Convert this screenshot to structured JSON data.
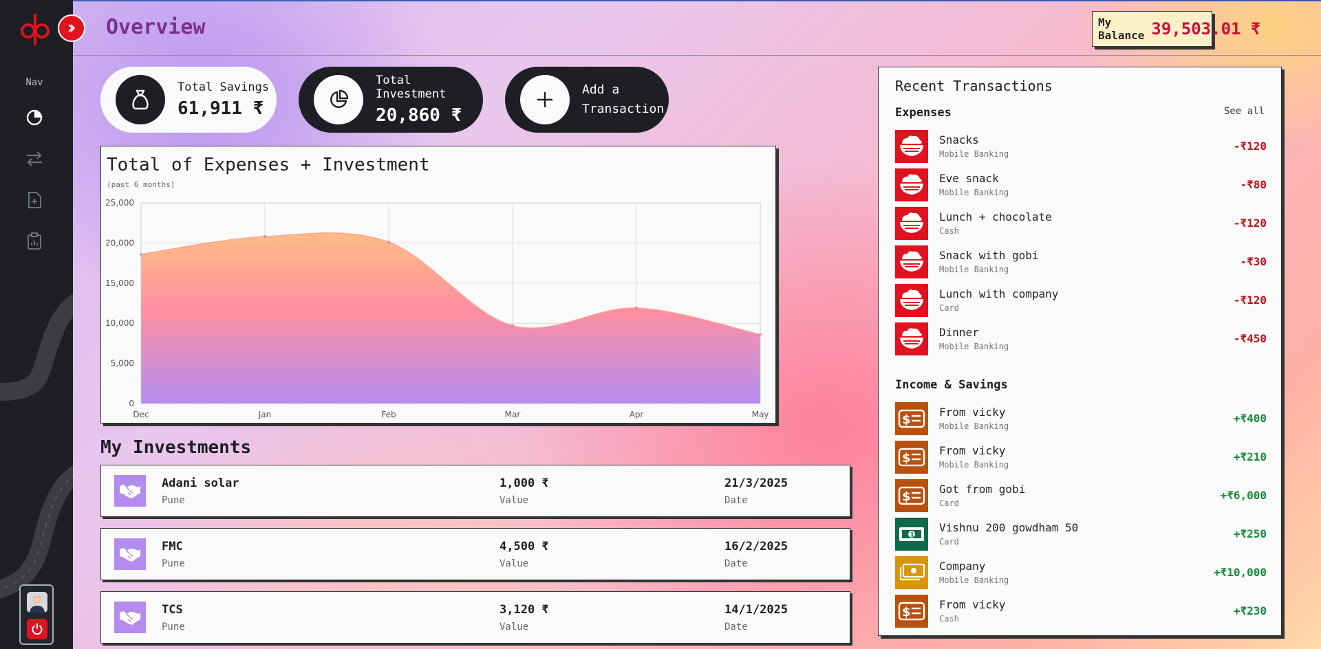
{
  "app": {
    "title": "Overview"
  },
  "sidebar": {
    "nav_label": "Nav"
  },
  "balance": {
    "label": "My Balance",
    "value": "39,503.01 ₹"
  },
  "stats": {
    "savings": {
      "label": "Total Savings",
      "value": "61,911 ₹"
    },
    "investment": {
      "label": "Total Investment",
      "value": "20,860 ₹"
    },
    "add": {
      "line1": "Add a",
      "line2": "Transaction"
    }
  },
  "chart": {
    "title": "Total of Expenses + Investment",
    "subtitle": "(past 6 months)"
  },
  "chart_data": {
    "type": "area",
    "title": "Total of Expenses + Investment",
    "subtitle": "(past 6 months)",
    "categories": [
      "Dec",
      "Jan",
      "Feb",
      "Mar",
      "Apr",
      "May"
    ],
    "series": [
      {
        "values": [
          18600,
          20800,
          20100,
          9700,
          11900,
          8600
        ]
      }
    ],
    "ylim": [
      0,
      25000
    ],
    "yticks": [
      0,
      5000,
      10000,
      15000,
      20000,
      25000
    ],
    "ytick_labels": [
      "0",
      "5,000",
      "10,000",
      "15,000",
      "20,000",
      "25,000"
    ],
    "grid": true,
    "colors": {
      "top": "#ffbd86",
      "mid": "#ff8fa0",
      "bottom": "#b48cf0"
    }
  },
  "investments": {
    "title": "My Investments",
    "items": [
      {
        "name": "Adani solar",
        "location": "Pune",
        "value": "1,000 ₹",
        "value_label": "Value",
        "date": "21/3/2025",
        "date_label": "Date"
      },
      {
        "name": "FMC",
        "location": "Pune",
        "value": "4,500 ₹",
        "value_label": "Value",
        "date": "16/2/2025",
        "date_label": "Date"
      },
      {
        "name": "TCS",
        "location": "Pune",
        "value": "3,120 ₹",
        "value_label": "Value",
        "date": "14/1/2025",
        "date_label": "Date"
      }
    ]
  },
  "transactions": {
    "title": "Recent Transactions",
    "see_all": "See all",
    "expenses_title": "Expenses",
    "income_title": "Income & Savings",
    "expenses": [
      {
        "name": "Snacks",
        "method": "Mobile Banking",
        "amount": "-₹120",
        "icon": "food-bowl-icon"
      },
      {
        "name": "Eve snack",
        "method": "Mobile Banking",
        "amount": "-₹80",
        "icon": "food-bowl-icon"
      },
      {
        "name": "Lunch + chocolate",
        "method": "Cash",
        "amount": "-₹120",
        "icon": "food-bowl-icon"
      },
      {
        "name": "Snack with gobi",
        "method": "Mobile Banking",
        "amount": "-₹30",
        "icon": "food-bowl-icon"
      },
      {
        "name": "Lunch with company",
        "method": "Card",
        "amount": "-₹120",
        "icon": "food-bowl-icon"
      },
      {
        "name": "Dinner",
        "method": "Mobile Banking",
        "amount": "-₹450",
        "icon": "food-bowl-icon"
      }
    ],
    "income": [
      {
        "name": "From vicky",
        "method": "Mobile Banking",
        "amount": "+₹400",
        "icon": "money-slip-icon",
        "color": "#b8500e"
      },
      {
        "name": "From vicky",
        "method": "Mobile Banking",
        "amount": "+₹210",
        "icon": "money-slip-icon",
        "color": "#b8500e"
      },
      {
        "name": "Got from gobi",
        "method": "Card",
        "amount": "+₹6,000",
        "icon": "money-slip-icon",
        "color": "#b8500e"
      },
      {
        "name": "Vishnu 200 gowdham 50",
        "method": "Card",
        "amount": "+₹250",
        "icon": "banknote-icon",
        "color": "#0f6a4a"
      },
      {
        "name": "Company",
        "method": "Mobile Banking",
        "amount": "+₹10,000",
        "icon": "cash-stack-icon",
        "color": "#d8940a"
      },
      {
        "name": "From vicky",
        "method": "Cash",
        "amount": "+₹230",
        "icon": "money-slip-icon",
        "color": "#b8500e"
      }
    ]
  },
  "colors": {
    "accent": "#e0121f",
    "sidebar": "#1d1f24",
    "title": "#7b2f8f",
    "negative": "#c0101a",
    "positive": "#1a8a3a"
  }
}
